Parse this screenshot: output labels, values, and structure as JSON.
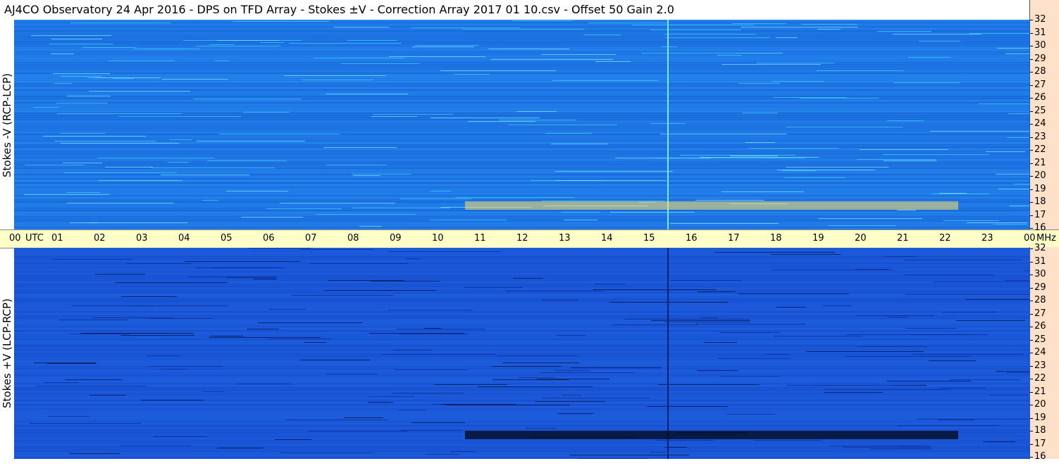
{
  "title": "AJ4CO Observatory  24 Apr 2016  -  DPS on TFD Array  -  Stokes ±V  -  Correction Array 2017 01 10.csv  -  Offset 50  Gain 2.0",
  "panels": [
    {
      "label": "Stokes -V (RCP-LCP)",
      "base_color": "#1f78e6",
      "accent": "#33b8ff"
    },
    {
      "label": "Stokes +V (LCP-RCP)",
      "base_color": "#1a56d8",
      "accent": "#2f7ff0"
    }
  ],
  "utc_axis": {
    "labels": [
      "00",
      "01",
      "02",
      "03",
      "04",
      "05",
      "06",
      "07",
      "08",
      "09",
      "10",
      "11",
      "12",
      "13",
      "14",
      "15",
      "16",
      "17",
      "18",
      "19",
      "20",
      "21",
      "22",
      "23",
      "00"
    ],
    "unit_utc": "UTC",
    "unit_mhz": "MHz"
  },
  "freq_axis": {
    "labels": [
      "32",
      "31",
      "30",
      "29",
      "28",
      "27",
      "26",
      "25",
      "24",
      "23",
      "22",
      "21",
      "20",
      "19",
      "18",
      "17",
      "16"
    ],
    "ylim": [
      16,
      32
    ]
  },
  "colors": {
    "strip": "#ffe0c8",
    "band": "#ffffc8"
  },
  "chart_data": {
    "type": "heatmap",
    "title": "AJ4CO Observatory  24 Apr 2016  -  DPS on TFD Array  -  Stokes ±V  -  Correction Array 2017 01 10.csv  -  Offset 50  Gain 2.0",
    "x_range_utc_hours": [
      0,
      24
    ],
    "y_range_mhz": [
      16,
      32
    ],
    "panels": [
      "Stokes -V (RCP-LCP)",
      "Stokes +V (LCP-RCP)"
    ]
  }
}
